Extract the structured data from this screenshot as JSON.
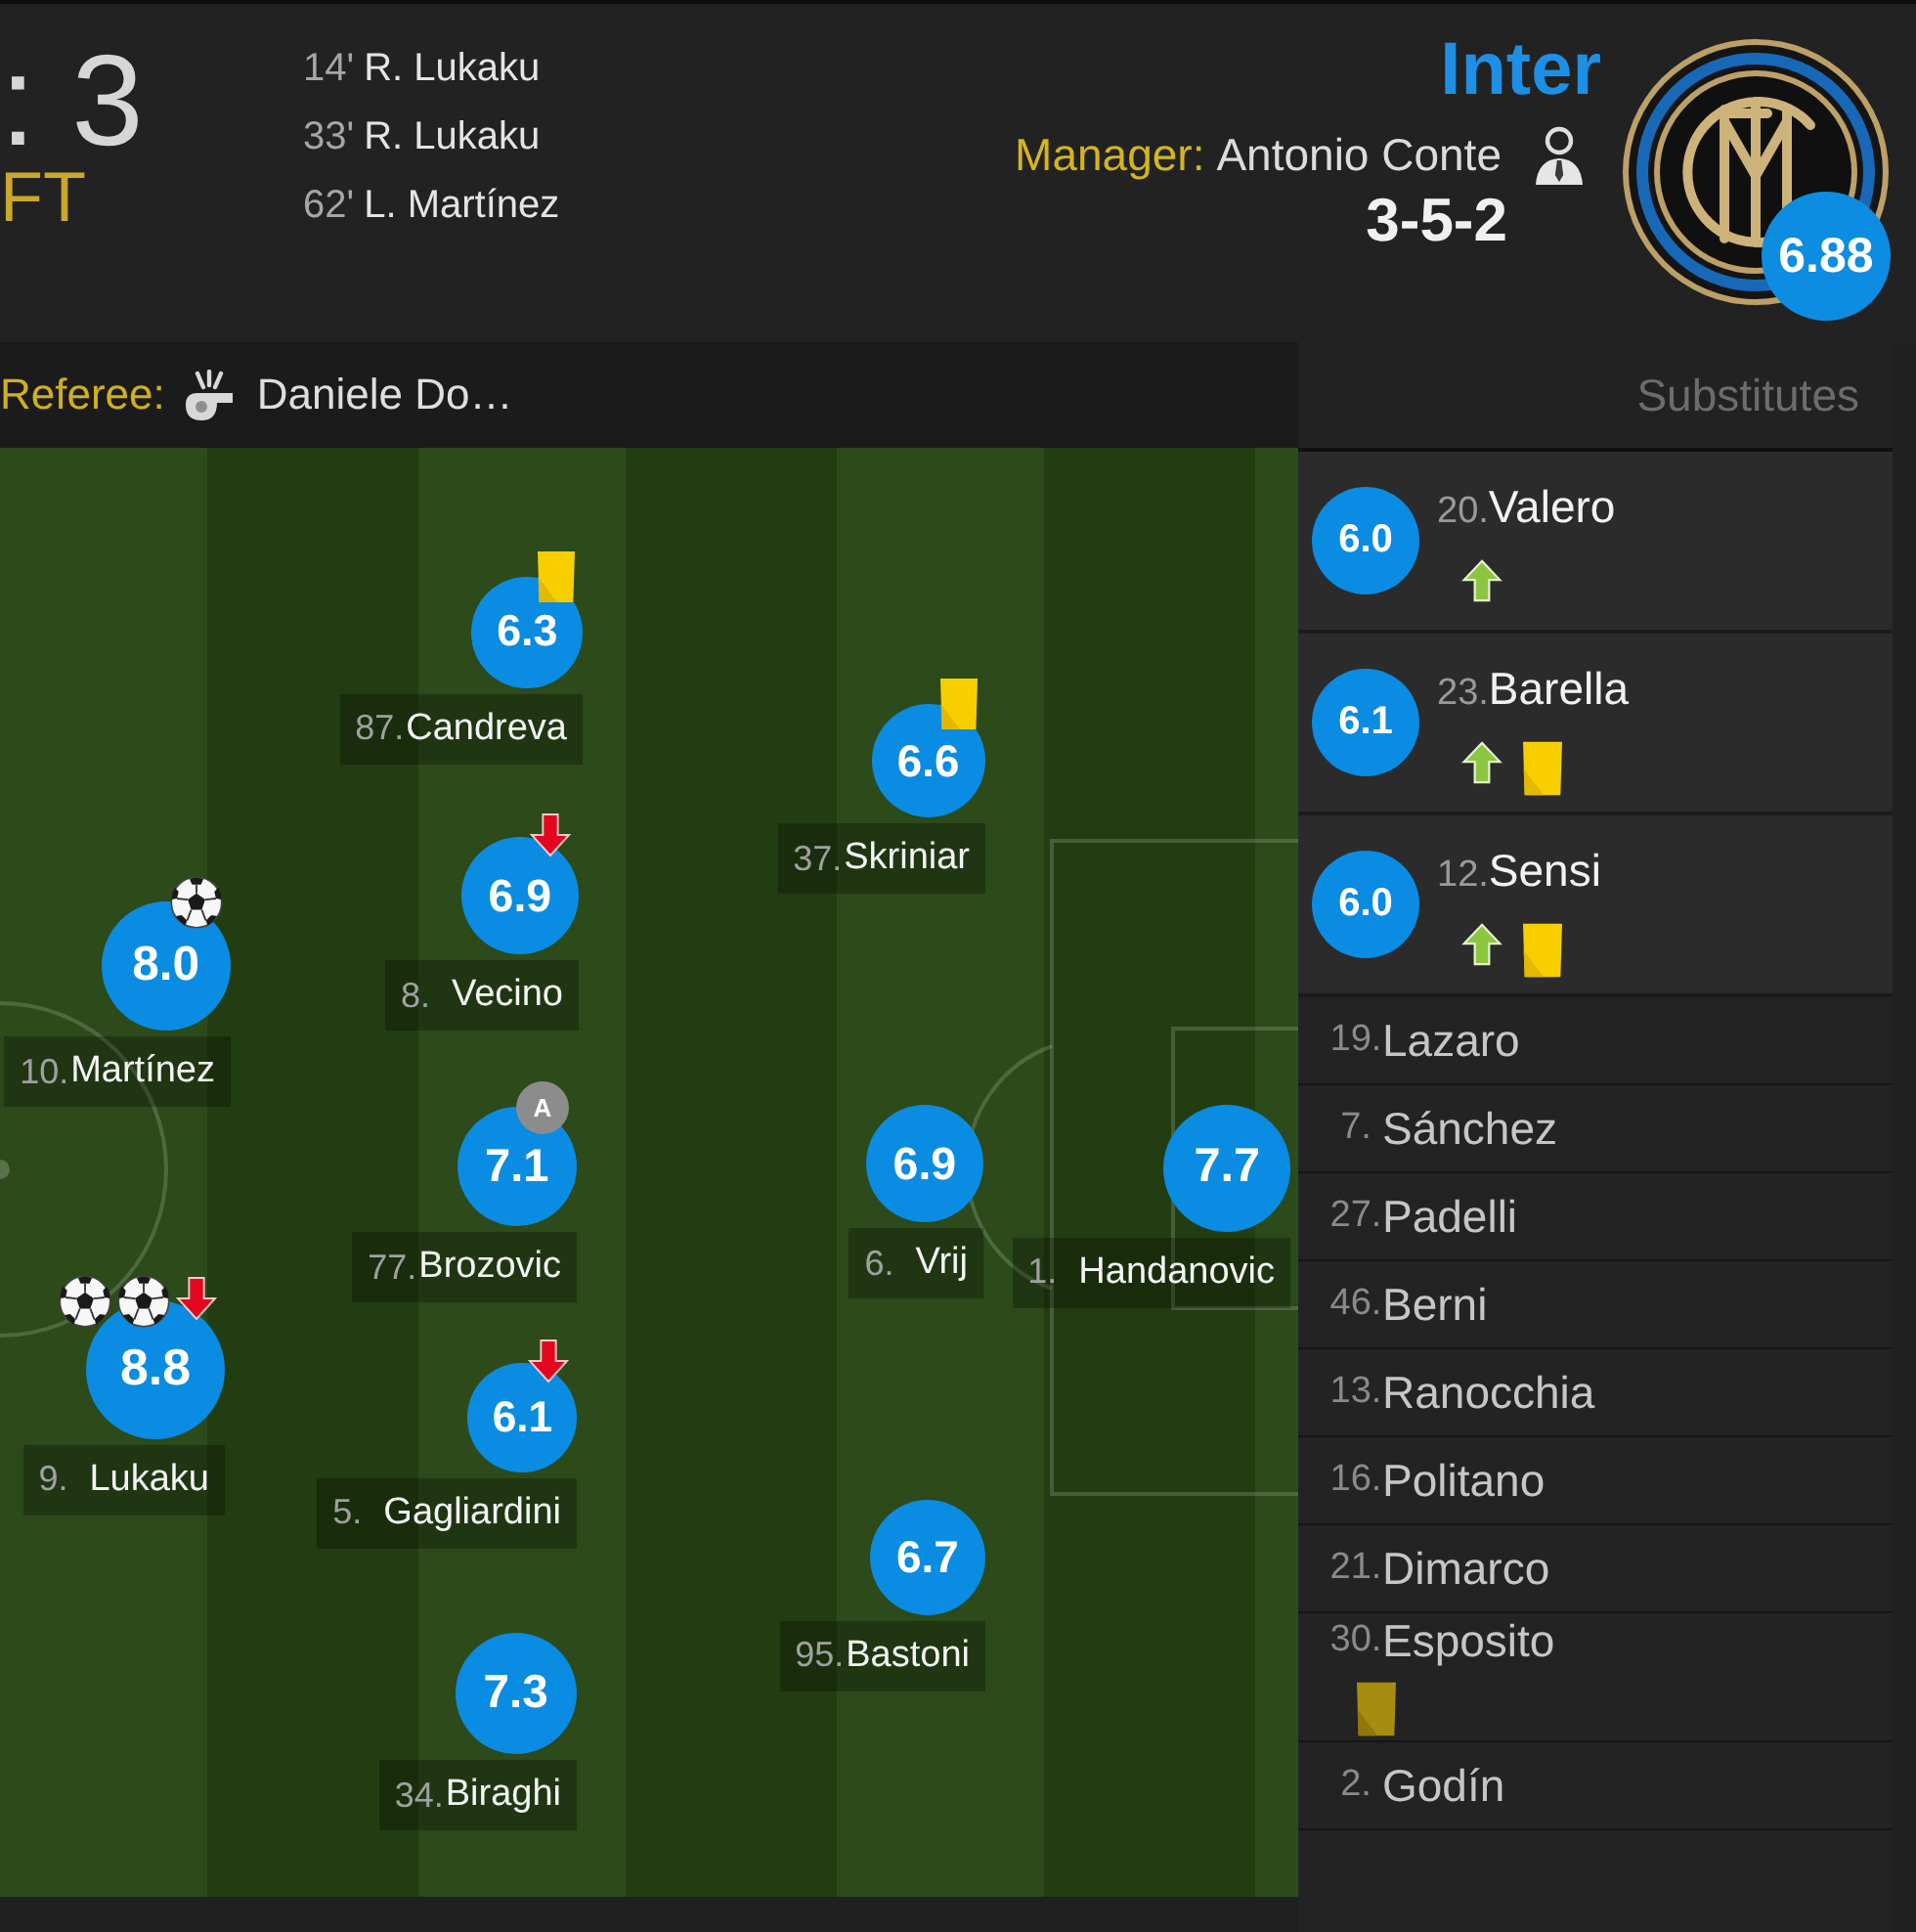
{
  "match": {
    "score": ": 3",
    "status": "FT"
  },
  "goals": [
    {
      "minute": "14'",
      "scorer": "R. Lukaku"
    },
    {
      "minute": "33'",
      "scorer": "R. Lukaku"
    },
    {
      "minute": "62'",
      "scorer": "L. Martínez"
    }
  ],
  "team": {
    "name": "Inter",
    "manager_label": "Manager:",
    "manager": "Antonio Conte",
    "formation": "3-5-2",
    "rating": "6.88"
  },
  "referee": {
    "label": "Referee:",
    "name": "Daniele Do…"
  },
  "pitch": {
    "players": [
      {
        "number": "87.",
        "name": "Candreva",
        "rating": "6.3",
        "events": [
          {
            "kind": "yellow_card"
          }
        ]
      },
      {
        "number": "37.",
        "name": "Skriniar",
        "rating": "6.6",
        "events": [
          {
            "kind": "yellow_card"
          }
        ]
      },
      {
        "number": "8.",
        "name": "Vecino",
        "rating": "6.9",
        "events": [
          {
            "kind": "sub_off"
          }
        ]
      },
      {
        "number": "10.",
        "name": "Martínez",
        "rating": "8.0",
        "events": [
          {
            "kind": "goal"
          }
        ]
      },
      {
        "number": "77.",
        "name": "Brozovic",
        "rating": "7.1",
        "events": [
          {
            "kind": "captain",
            "label": "A"
          }
        ]
      },
      {
        "number": "6.",
        "name": "Vrij",
        "rating": "6.9"
      },
      {
        "number": "1.",
        "name": "Handanovic",
        "rating": "7.7"
      },
      {
        "number": "9.",
        "name": "Lukaku",
        "rating": "8.8",
        "events": [
          {
            "kind": "goal"
          },
          {
            "kind": "goal"
          },
          {
            "kind": "sub_off"
          }
        ]
      },
      {
        "number": "5.",
        "name": "Gagliardini",
        "rating": "6.1",
        "events": [
          {
            "kind": "sub_off"
          }
        ]
      },
      {
        "number": "95.",
        "name": "Bastoni",
        "rating": "6.7"
      },
      {
        "number": "34.",
        "name": "Biraghi",
        "rating": "7.3"
      }
    ]
  },
  "substitutes": {
    "title": "Substitutes",
    "players": [
      {
        "kind": "played",
        "number": "20.",
        "name": "Valero",
        "rating": "6.0",
        "events": [
          {
            "kind": "sub_on"
          }
        ]
      },
      {
        "kind": "played",
        "number": "23.",
        "name": "Barella",
        "rating": "6.1",
        "events": [
          {
            "kind": "sub_on"
          },
          {
            "kind": "yellow_card"
          }
        ]
      },
      {
        "kind": "played",
        "number": "12.",
        "name": "Sensi",
        "rating": "6.0",
        "events": [
          {
            "kind": "sub_on"
          },
          {
            "kind": "yellow_card"
          }
        ]
      },
      {
        "kind": "unused",
        "number": "19.",
        "name": "Lazaro"
      },
      {
        "kind": "unused",
        "number": "7.",
        "name": "Sánchez"
      },
      {
        "kind": "unused",
        "number": "27.",
        "name": "Padelli"
      },
      {
        "kind": "unused",
        "number": "46.",
        "name": "Berni"
      },
      {
        "kind": "unused",
        "number": "13.",
        "name": "Ranocchia"
      },
      {
        "kind": "unused",
        "number": "16.",
        "name": "Politano"
      },
      {
        "kind": "unused",
        "number": "21.",
        "name": "Dimarco"
      },
      {
        "kind": "unused",
        "number": "30.",
        "name": "Esposito",
        "events": [
          {
            "kind": "yellow_card"
          }
        ]
      },
      {
        "kind": "unused",
        "number": "2.",
        "name": "Godín"
      }
    ]
  }
}
